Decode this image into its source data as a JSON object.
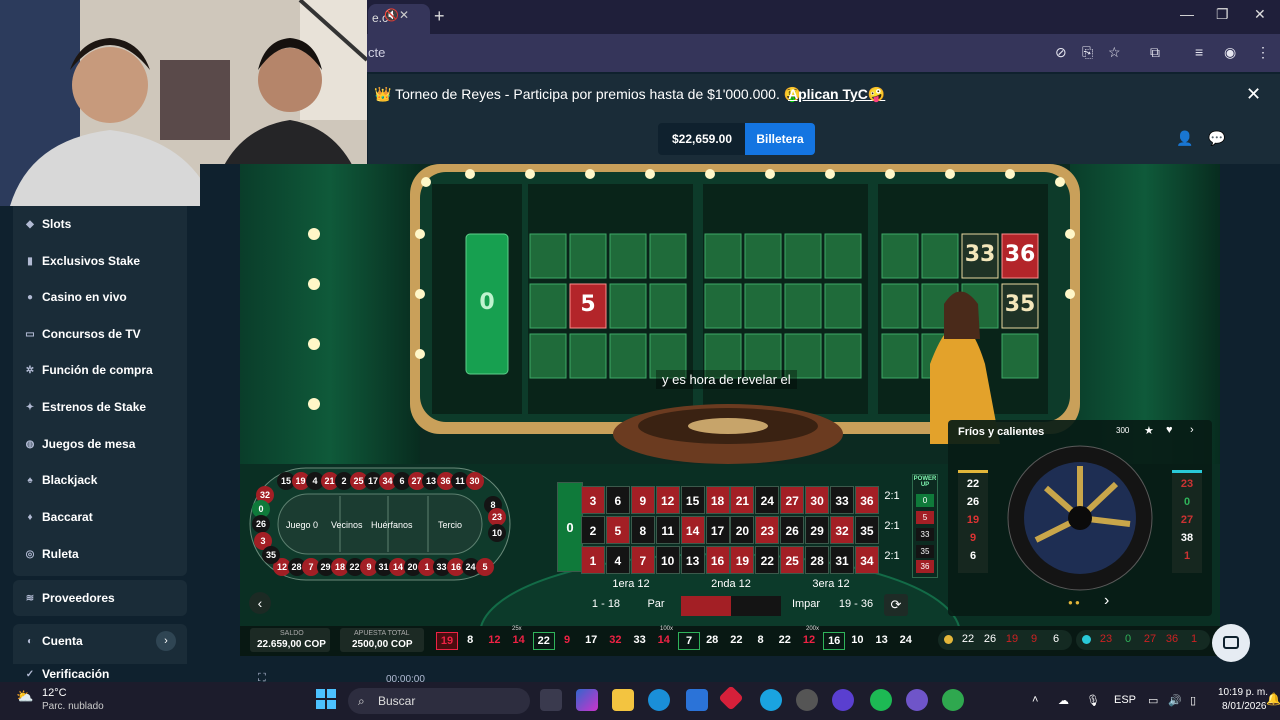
{
  "browser": {
    "tab_title": "e.c",
    "address_text": "cte",
    "new_tab": "+"
  },
  "banner": {
    "text": "👑 Torneo de Reyes - Participa por premios hasta de $1'000.000. 🤑",
    "link": "Aplican TyC🤪"
  },
  "header": {
    "balance": "$22,659.00",
    "wallet": "Billetera"
  },
  "sidebar": {
    "items": [
      {
        "label": "Slots"
      },
      {
        "label": "Exclusivos Stake"
      },
      {
        "label": "Casino en vivo"
      },
      {
        "label": "Concursos de TV"
      },
      {
        "label": "Función de compra"
      },
      {
        "label": "Estrenos de Stake"
      },
      {
        "label": "Juegos de mesa"
      },
      {
        "label": "Blackjack"
      },
      {
        "label": "Baccarat"
      },
      {
        "label": "Ruleta"
      }
    ],
    "providers": "Proveedores",
    "account": "Cuenta",
    "verification": "Verificación"
  },
  "game": {
    "subtitle": "y es hora de revelar el",
    "board_zero": "0",
    "board_five": "5",
    "board_33": "33",
    "board_36": "36",
    "board_35": "35",
    "grid": {
      "zero": "0",
      "rows": [
        [
          "3",
          "6",
          "9",
          "12",
          "15",
          "18",
          "21",
          "24",
          "27",
          "30",
          "33",
          "36"
        ],
        [
          "2",
          "5",
          "8",
          "11",
          "14",
          "17",
          "20",
          "23",
          "26",
          "29",
          "32",
          "35"
        ],
        [
          "1",
          "4",
          "7",
          "10",
          "13",
          "16",
          "19",
          "22",
          "25",
          "28",
          "31",
          "34"
        ]
      ],
      "row_colors": [
        [
          "r",
          "b",
          "r",
          "r",
          "b",
          "r",
          "r",
          "b",
          "r",
          "r",
          "b",
          "r"
        ],
        [
          "b",
          "r",
          "b",
          "b",
          "r",
          "b",
          "b",
          "r",
          "b",
          "b",
          "r",
          "b"
        ],
        [
          "r",
          "b",
          "r",
          "b",
          "b",
          "r",
          "r",
          "b",
          "r",
          "b",
          "b",
          "r"
        ]
      ],
      "columns": [
        "2:1",
        "2:1",
        "2:1"
      ],
      "dozens": [
        "1era 12",
        "2nda 12",
        "3era 12"
      ],
      "outside": [
        "1 - 18",
        "Par",
        "",
        "",
        "Impar",
        "19 - 36"
      ]
    },
    "power_up": {
      "label": "POWER UP",
      "values": [
        "0",
        "5",
        "33",
        "35",
        "36"
      ]
    },
    "racetrack": {
      "top": [
        "15",
        "19",
        "4",
        "21",
        "2",
        "25",
        "17",
        "34",
        "6",
        "27",
        "13",
        "36",
        "11",
        "30"
      ],
      "bottom": [
        "12",
        "28",
        "7",
        "29",
        "18",
        "22",
        "9",
        "31",
        "14",
        "20",
        "1",
        "33",
        "16",
        "24",
        "5"
      ],
      "left": [
        "32",
        "0",
        "26",
        "3",
        "35"
      ],
      "right": [
        "8",
        "23",
        "10"
      ],
      "labels": [
        "Juego 0",
        "Vecinos",
        "Huérfanos",
        "Tercio"
      ]
    },
    "hot_cold": {
      "title": "Fríos y calientes",
      "count": "300",
      "hot": [
        "22",
        "26",
        "19",
        "9",
        "6"
      ],
      "cold": [
        "23",
        "0",
        "27",
        "38",
        "1"
      ]
    },
    "balance_label": "SALDO",
    "balance_value": "22.659,00 COP",
    "total_bet_label": "APUESTA TOTAL",
    "total_bet_value": "2500,00 COP",
    "history": [
      "19",
      "8",
      "12",
      "14",
      "22",
      "9",
      "17",
      "32",
      "33",
      "14",
      "7",
      "28",
      "22",
      "8",
      "22",
      "12",
      "16",
      "10",
      "13",
      "24"
    ],
    "history_colors": [
      "r",
      "b",
      "r",
      "r",
      "g",
      "r",
      "b",
      "r",
      "b",
      "r",
      "g",
      "b",
      "b",
      "b",
      "b",
      "r",
      "g",
      "b",
      "b",
      "b"
    ],
    "history_multipliers": [
      "25x",
      "100x",
      "200x"
    ],
    "footer_hot": [
      "22",
      "26",
      "19",
      "9",
      "6"
    ],
    "footer_cold": [
      "23",
      "0",
      "27",
      "36",
      "1"
    ]
  },
  "taskbar": {
    "weather_temp": "12°C",
    "weather_desc": "Parc. nublado",
    "search": "Buscar",
    "lang": "ESP",
    "time": "10:19 p. m.",
    "date": "8/01/2026"
  },
  "below_game": {
    "timer": "00:00:00"
  }
}
